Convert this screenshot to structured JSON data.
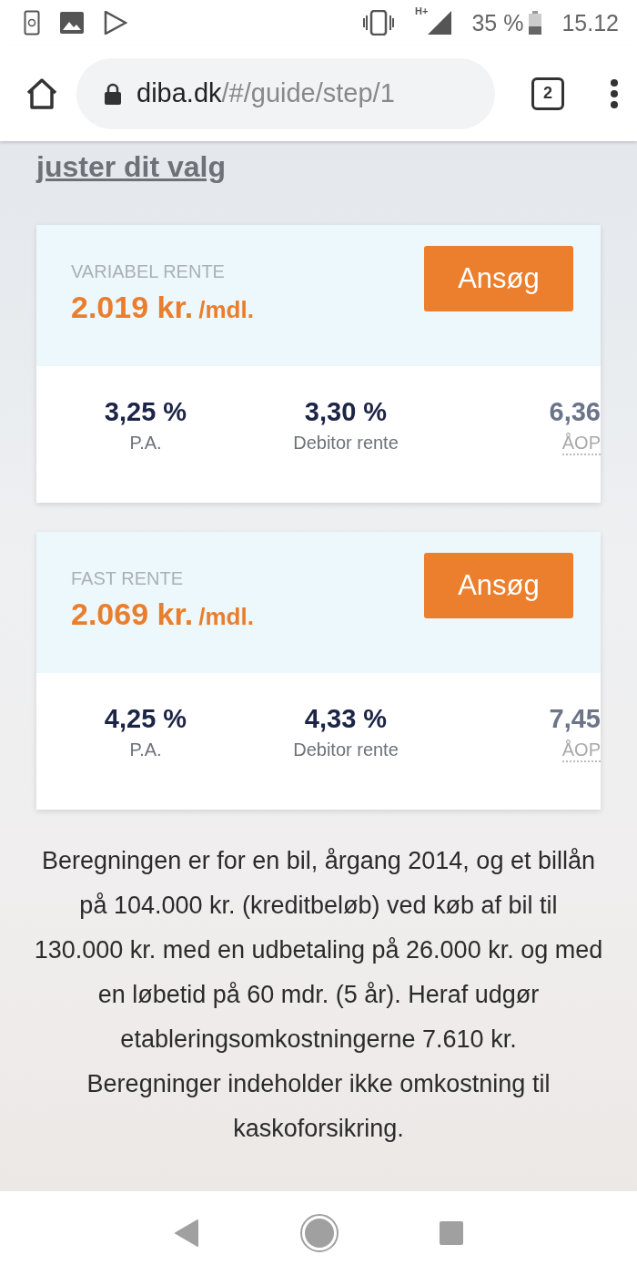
{
  "status_bar": {
    "battery": "35 %",
    "time": "15.12",
    "network": "H+"
  },
  "browser": {
    "url_host": "diba.dk",
    "url_path": "/#/guide/step/1",
    "tab_count": "2"
  },
  "heading": "juster dit valg",
  "offers": [
    {
      "title": "VARIABEL RENTE",
      "amount": "2.019 kr.",
      "unit": "/mdl.",
      "button": "Ansøg",
      "stats": [
        {
          "value": "3,25 %",
          "label": "P.A.",
          "faded": false
        },
        {
          "value": "3,30 %",
          "label": "Debitor rente",
          "faded": false
        },
        {
          "value": "6,36",
          "label": "ÅOP",
          "faded": true
        }
      ]
    },
    {
      "title": "FAST RENTE",
      "amount": "2.069 kr.",
      "unit": "/mdl.",
      "button": "Ansøg",
      "stats": [
        {
          "value": "4,25 %",
          "label": "P.A.",
          "faded": false
        },
        {
          "value": "4,33 %",
          "label": "Debitor rente",
          "faded": false
        },
        {
          "value": "7,45",
          "label": "ÅOP",
          "faded": true
        }
      ]
    }
  ],
  "note": "Beregningen er for en bil, årgang 2014, og et billån på 104.000 kr. (kreditbeløb) ved køb af bil til 130.000 kr. med en udbetaling på 26.000 kr. og med en løbetid på 60 mdr. (5 år). Heraf udgør etableringsomkostningerne 7.610 kr.",
  "note_2": "Beregninger indeholder ikke omkostning til kaskoforsikring."
}
